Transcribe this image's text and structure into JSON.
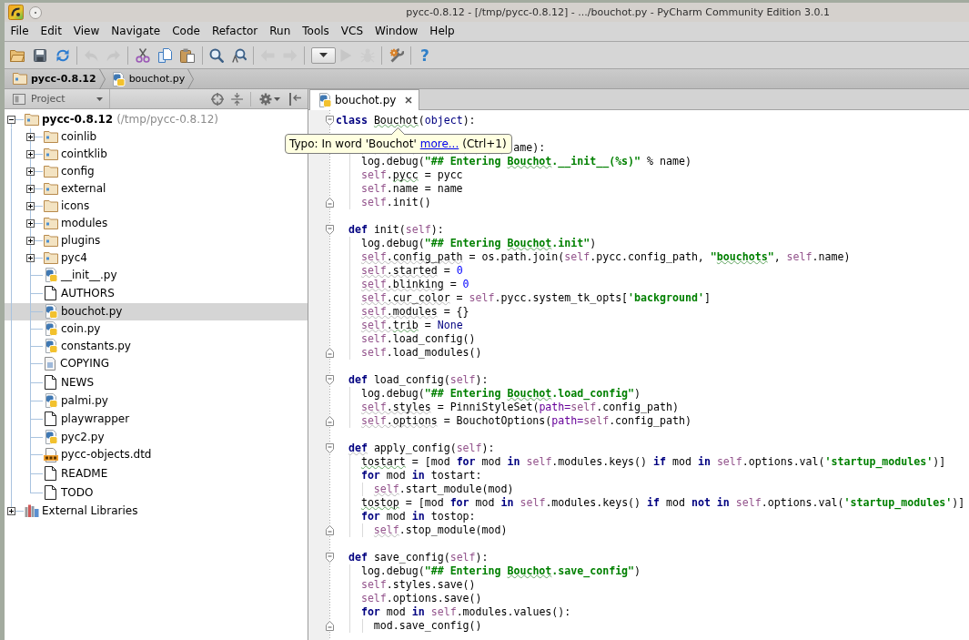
{
  "window": {
    "title": "pycc-0.8.12 - [/tmp/pycc-0.8.12] - .../bouchot.py - PyCharm Community Edition 3.0.1"
  },
  "menu": [
    {
      "label": "File"
    },
    {
      "label": "Edit"
    },
    {
      "label": "View"
    },
    {
      "label": "Navigate"
    },
    {
      "label": "Code"
    },
    {
      "label": "Refactor"
    },
    {
      "label": "Run"
    },
    {
      "label": "Tools"
    },
    {
      "label": "VCS"
    },
    {
      "label": "Window"
    },
    {
      "label": "Help"
    }
  ],
  "toolbar": [
    {
      "kind": "button",
      "disabled": false
    },
    {
      "kind": "button",
      "disabled": false
    },
    {
      "kind": "button",
      "disabled": false
    },
    {
      "kind": "separator"
    },
    {
      "kind": "button",
      "disabled": true
    },
    {
      "kind": "button",
      "disabled": true
    },
    {
      "kind": "separator"
    },
    {
      "kind": "button",
      "disabled": false
    },
    {
      "kind": "button",
      "disabled": false
    },
    {
      "kind": "button",
      "disabled": false
    },
    {
      "kind": "separator"
    },
    {
      "kind": "button",
      "disabled": false
    },
    {
      "kind": "button",
      "disabled": false
    },
    {
      "kind": "separator"
    },
    {
      "kind": "button",
      "disabled": true
    },
    {
      "kind": "button",
      "disabled": true
    },
    {
      "kind": "separator"
    },
    {
      "kind": "dropdown",
      "disabled": false
    },
    {
      "kind": "button",
      "disabled": true
    },
    {
      "kind": "button",
      "disabled": true
    },
    {
      "kind": "separator"
    },
    {
      "kind": "button",
      "disabled": false
    },
    {
      "kind": "separator"
    },
    {
      "kind": "glyph",
      "text": "?",
      "disabled": false
    }
  ],
  "breadcrumbs": [
    {
      "label": "pycc-0.8.12",
      "kind": "project"
    },
    {
      "label": "bouchot.py",
      "kind": "python"
    }
  ],
  "project_panel": {
    "title": "Project",
    "tree": [
      {
        "label": "pycc-0.8.12",
        "detail": "(/tmp/pycc-0.8.12)",
        "kind": "project",
        "expanded": true,
        "selected": false,
        "children": [
          {
            "label": "coinlib",
            "kind": "package",
            "expanded": false,
            "selected": false
          },
          {
            "label": "cointklib",
            "kind": "package",
            "expanded": false,
            "selected": false
          },
          {
            "label": "config",
            "kind": "folder",
            "expanded": false,
            "selected": false
          },
          {
            "label": "external",
            "kind": "package",
            "expanded": false,
            "selected": false
          },
          {
            "label": "icons",
            "kind": "folder",
            "expanded": false,
            "selected": false
          },
          {
            "label": "modules",
            "kind": "package",
            "expanded": false,
            "selected": false
          },
          {
            "label": "plugins",
            "kind": "package",
            "expanded": false,
            "selected": false
          },
          {
            "label": "pyc4",
            "kind": "package",
            "expanded": false,
            "selected": false
          },
          {
            "label": "__init__.py",
            "kind": "python",
            "selected": false
          },
          {
            "label": "AUTHORS",
            "kind": "file",
            "selected": false
          },
          {
            "label": "bouchot.py",
            "kind": "python",
            "selected": true
          },
          {
            "label": "coin.py",
            "kind": "python",
            "selected": false
          },
          {
            "label": "constants.py",
            "kind": "python",
            "selected": false
          },
          {
            "label": "COPYING",
            "kind": "document",
            "selected": false
          },
          {
            "label": "NEWS",
            "kind": "file",
            "selected": false
          },
          {
            "label": "palmi.py",
            "kind": "python",
            "selected": false
          },
          {
            "label": "playwrapper",
            "kind": "file",
            "selected": false
          },
          {
            "label": "pyc2.py",
            "kind": "python",
            "selected": false
          },
          {
            "label": "pycc-objects.dtd",
            "kind": "dtd",
            "selected": false
          },
          {
            "label": "README",
            "kind": "file",
            "selected": false
          },
          {
            "label": "TODO",
            "kind": "file",
            "selected": false
          }
        ]
      },
      {
        "label": "External Libraries",
        "kind": "library",
        "expanded": false,
        "selected": false
      }
    ]
  },
  "editor": {
    "tabs": [
      {
        "label": "bouchot.py",
        "kind": "python",
        "selected": true
      }
    ],
    "lines": [
      {
        "kind": "code",
        "fold": {
          "kind": "start"
        },
        "segments": [
          {
            "text": "class ",
            "kind": "keyword"
          },
          {
            "text": "Bouchot",
            "kind": "plain",
            "squiggle": {
              "kind": "typo"
            }
          },
          {
            "text": "(",
            "kind": "plain"
          },
          {
            "text": "object",
            "kind": "builtin"
          },
          {
            "text": "):",
            "kind": "plain"
          }
        ]
      },
      {
        "kind": "blank"
      },
      {
        "kind": "code",
        "segments": [
          {
            "text": "                            ame):",
            "kind": "plain"
          }
        ]
      },
      {
        "kind": "code",
        "segments": [
          {
            "text": "    log.debug(",
            "kind": "plain"
          },
          {
            "text": "\"## Entering ",
            "kind": "string"
          },
          {
            "text": "Bouchot",
            "kind": "string",
            "squiggle": {
              "kind": "typo"
            }
          },
          {
            "text": ".__init__(%s)\"",
            "kind": "string"
          },
          {
            "text": " % name)",
            "kind": "plain"
          }
        ]
      },
      {
        "kind": "code",
        "segments": [
          {
            "text": "    self",
            "kind": "self"
          },
          {
            "text": ".",
            "kind": "plain"
          },
          {
            "text": "pycc",
            "kind": "plain",
            "squiggle": {
              "kind": "typo"
            }
          },
          {
            "text": " = pycc",
            "kind": "plain"
          }
        ]
      },
      {
        "kind": "code",
        "segments": [
          {
            "text": "    self",
            "kind": "self"
          },
          {
            "text": ".name = name",
            "kind": "plain"
          }
        ]
      },
      {
        "kind": "code",
        "fold": {
          "kind": "end"
        },
        "segments": [
          {
            "text": "    self",
            "kind": "self"
          },
          {
            "text": ".init()",
            "kind": "plain"
          }
        ]
      },
      {
        "kind": "blank"
      },
      {
        "kind": "code",
        "fold": {
          "kind": "start"
        },
        "segments": [
          {
            "text": "  def",
            "kind": "keyword"
          },
          {
            "text": " init(",
            "kind": "plain"
          },
          {
            "text": "self",
            "kind": "self"
          },
          {
            "text": "):",
            "kind": "plain"
          }
        ]
      },
      {
        "kind": "code",
        "segments": [
          {
            "text": "    log.debug(",
            "kind": "plain"
          },
          {
            "text": "\"## Entering ",
            "kind": "string"
          },
          {
            "text": "Bouchot",
            "kind": "string",
            "squiggle": {
              "kind": "typo"
            }
          },
          {
            "text": ".init\"",
            "kind": "string"
          },
          {
            "text": ")",
            "kind": "plain"
          }
        ]
      },
      {
        "kind": "code",
        "segments": [
          {
            "text": "    self",
            "kind": "self",
            "squiggle": {
              "kind": "warning"
            }
          },
          {
            "text": ".config_path",
            "kind": "plain",
            "squiggle": {
              "kind": "warning"
            }
          },
          {
            "text": " = os.path.join(",
            "kind": "plain"
          },
          {
            "text": "self",
            "kind": "self"
          },
          {
            "text": ".pycc.config_path, ",
            "kind": "plain"
          },
          {
            "text": "\"",
            "kind": "string"
          },
          {
            "text": "bouchots",
            "kind": "string",
            "squiggle": {
              "kind": "typo"
            }
          },
          {
            "text": "\"",
            "kind": "string"
          },
          {
            "text": ", ",
            "kind": "plain"
          },
          {
            "text": "self",
            "kind": "self"
          },
          {
            "text": ".name)",
            "kind": "plain"
          }
        ]
      },
      {
        "kind": "code",
        "segments": [
          {
            "text": "    self",
            "kind": "self",
            "squiggle": {
              "kind": "warning"
            }
          },
          {
            "text": ".started",
            "kind": "plain",
            "squiggle": {
              "kind": "warning"
            }
          },
          {
            "text": " = ",
            "kind": "plain"
          },
          {
            "text": "0",
            "kind": "number"
          }
        ]
      },
      {
        "kind": "code",
        "segments": [
          {
            "text": "    self",
            "kind": "self",
            "squiggle": {
              "kind": "warning"
            }
          },
          {
            "text": ".blinking",
            "kind": "plain",
            "squiggle": {
              "kind": "warning"
            }
          },
          {
            "text": " = ",
            "kind": "plain"
          },
          {
            "text": "0",
            "kind": "number"
          }
        ]
      },
      {
        "kind": "code",
        "segments": [
          {
            "text": "    self",
            "kind": "self",
            "squiggle": {
              "kind": "warning"
            }
          },
          {
            "text": ".cur_color",
            "kind": "plain",
            "squiggle": {
              "kind": "warning"
            }
          },
          {
            "text": " = ",
            "kind": "plain"
          },
          {
            "text": "self",
            "kind": "self"
          },
          {
            "text": ".pycc.system_tk_opts[",
            "kind": "plain"
          },
          {
            "text": "'background'",
            "kind": "string"
          },
          {
            "text": "]",
            "kind": "plain"
          }
        ]
      },
      {
        "kind": "code",
        "segments": [
          {
            "text": "    self",
            "kind": "self",
            "squiggle": {
              "kind": "warning"
            }
          },
          {
            "text": ".modules",
            "kind": "plain",
            "squiggle": {
              "kind": "warning"
            }
          },
          {
            "text": " = {}",
            "kind": "plain"
          }
        ]
      },
      {
        "kind": "code",
        "segments": [
          {
            "text": "    self",
            "kind": "self",
            "squiggle": {
              "kind": "warning"
            }
          },
          {
            "text": ".",
            "kind": "plain",
            "squiggle": {
              "kind": "warning"
            }
          },
          {
            "text": "trib",
            "kind": "plain",
            "squiggle": {
              "kind": "typo"
            }
          },
          {
            "text": " = ",
            "kind": "plain"
          },
          {
            "text": "None",
            "kind": "constant"
          }
        ]
      },
      {
        "kind": "code",
        "segments": [
          {
            "text": "    self",
            "kind": "self"
          },
          {
            "text": ".load_config()",
            "kind": "plain"
          }
        ]
      },
      {
        "kind": "code",
        "fold": {
          "kind": "end"
        },
        "segments": [
          {
            "text": "    self",
            "kind": "self"
          },
          {
            "text": ".load_modules()",
            "kind": "plain"
          }
        ]
      },
      {
        "kind": "blank"
      },
      {
        "kind": "code",
        "fold": {
          "kind": "start"
        },
        "segments": [
          {
            "text": "  def",
            "kind": "keyword"
          },
          {
            "text": " load_config(",
            "kind": "plain"
          },
          {
            "text": "self",
            "kind": "self"
          },
          {
            "text": "):",
            "kind": "plain"
          }
        ]
      },
      {
        "kind": "code",
        "segments": [
          {
            "text": "    log.debug(",
            "kind": "plain"
          },
          {
            "text": "\"## Entering ",
            "kind": "string"
          },
          {
            "text": "Bouchot",
            "kind": "string",
            "squiggle": {
              "kind": "typo"
            }
          },
          {
            "text": ".load_config\"",
            "kind": "string"
          },
          {
            "text": ")",
            "kind": "plain"
          }
        ]
      },
      {
        "kind": "code",
        "segments": [
          {
            "text": "    self",
            "kind": "self",
            "squiggle": {
              "kind": "warning"
            }
          },
          {
            "text": ".styles",
            "kind": "plain",
            "squiggle": {
              "kind": "warning"
            }
          },
          {
            "text": " = PinniStyleSet(",
            "kind": "plain"
          },
          {
            "text": "path=",
            "kind": "param"
          },
          {
            "text": "self",
            "kind": "self"
          },
          {
            "text": ".config_path)",
            "kind": "plain"
          }
        ]
      },
      {
        "kind": "code",
        "fold": {
          "kind": "end"
        },
        "segments": [
          {
            "text": "    self",
            "kind": "self",
            "squiggle": {
              "kind": "warning"
            }
          },
          {
            "text": ".options",
            "kind": "plain",
            "squiggle": {
              "kind": "warning"
            }
          },
          {
            "text": " = BouchotOptions(",
            "kind": "plain"
          },
          {
            "text": "path=",
            "kind": "param"
          },
          {
            "text": "self",
            "kind": "self"
          },
          {
            "text": ".config_path)",
            "kind": "plain"
          }
        ]
      },
      {
        "kind": "blank"
      },
      {
        "kind": "code",
        "fold": {
          "kind": "start"
        },
        "segments": [
          {
            "text": "  def",
            "kind": "keyword",
            "squiggle": {
              "kind": "warning"
            }
          },
          {
            "text": " apply_config(",
            "kind": "plain"
          },
          {
            "text": "self",
            "kind": "self"
          },
          {
            "text": "):",
            "kind": "plain"
          }
        ]
      },
      {
        "kind": "code",
        "segments": [
          {
            "text": "    tostart",
            "kind": "plain",
            "squiggle": {
              "kind": "typo"
            }
          },
          {
            "text": " = [mod ",
            "kind": "plain"
          },
          {
            "text": "for",
            "kind": "keyword"
          },
          {
            "text": " mod ",
            "kind": "plain"
          },
          {
            "text": "in ",
            "kind": "keyword"
          },
          {
            "text": "self",
            "kind": "self"
          },
          {
            "text": ".modules.keys() ",
            "kind": "plain"
          },
          {
            "text": "if",
            "kind": "keyword"
          },
          {
            "text": " mod ",
            "kind": "plain"
          },
          {
            "text": "in ",
            "kind": "keyword"
          },
          {
            "text": "self",
            "kind": "self"
          },
          {
            "text": ".options.val(",
            "kind": "plain"
          },
          {
            "text": "'startup_modules'",
            "kind": "string"
          },
          {
            "text": ")]",
            "kind": "plain"
          }
        ]
      },
      {
        "kind": "code",
        "segments": [
          {
            "text": "    for",
            "kind": "keyword"
          },
          {
            "text": " mod ",
            "kind": "plain"
          },
          {
            "text": "in",
            "kind": "keyword"
          },
          {
            "text": " tostart:",
            "kind": "plain"
          }
        ]
      },
      {
        "kind": "code",
        "segments": [
          {
            "text": "      self",
            "kind": "self",
            "squiggle": {
              "kind": "warning"
            }
          },
          {
            "text": ".start_module(mod)",
            "kind": "plain"
          }
        ]
      },
      {
        "kind": "code",
        "segments": [
          {
            "text": "    tostop",
            "kind": "plain",
            "squiggle": {
              "kind": "typo"
            }
          },
          {
            "text": " = [mod ",
            "kind": "plain"
          },
          {
            "text": "for",
            "kind": "keyword"
          },
          {
            "text": " mod ",
            "kind": "plain"
          },
          {
            "text": "in ",
            "kind": "keyword"
          },
          {
            "text": "self",
            "kind": "self"
          },
          {
            "text": ".modules.keys() ",
            "kind": "plain"
          },
          {
            "text": "if",
            "kind": "keyword"
          },
          {
            "text": " mod ",
            "kind": "plain"
          },
          {
            "text": "not in ",
            "kind": "keyword"
          },
          {
            "text": "self",
            "kind": "self"
          },
          {
            "text": ".options.val(",
            "kind": "plain"
          },
          {
            "text": "'startup_modules'",
            "kind": "string"
          },
          {
            "text": ")]",
            "kind": "plain"
          }
        ]
      },
      {
        "kind": "code",
        "segments": [
          {
            "text": "    for",
            "kind": "keyword"
          },
          {
            "text": " mod ",
            "kind": "plain"
          },
          {
            "text": "in",
            "kind": "keyword"
          },
          {
            "text": " tostop:",
            "kind": "plain"
          }
        ]
      },
      {
        "kind": "code",
        "fold": {
          "kind": "end"
        },
        "segments": [
          {
            "text": "      self",
            "kind": "self",
            "squiggle": {
              "kind": "warning"
            }
          },
          {
            "text": ".stop_module(mod)",
            "kind": "plain"
          }
        ]
      },
      {
        "kind": "blank"
      },
      {
        "kind": "code",
        "fold": {
          "kind": "start"
        },
        "segments": [
          {
            "text": "  def",
            "kind": "keyword"
          },
          {
            "text": " save_config(",
            "kind": "plain"
          },
          {
            "text": "self",
            "kind": "self"
          },
          {
            "text": "):",
            "kind": "plain"
          }
        ]
      },
      {
        "kind": "code",
        "segments": [
          {
            "text": "    log.debug(",
            "kind": "plain"
          },
          {
            "text": "\"## Entering ",
            "kind": "string"
          },
          {
            "text": "Bouchot",
            "kind": "string",
            "squiggle": {
              "kind": "typo"
            }
          },
          {
            "text": ".save_config\"",
            "kind": "string"
          },
          {
            "text": ")",
            "kind": "plain"
          }
        ]
      },
      {
        "kind": "code",
        "segments": [
          {
            "text": "    self",
            "kind": "self"
          },
          {
            "text": ".styles.save()",
            "kind": "plain"
          }
        ]
      },
      {
        "kind": "code",
        "segments": [
          {
            "text": "    self",
            "kind": "self"
          },
          {
            "text": ".options.save()",
            "kind": "plain"
          }
        ]
      },
      {
        "kind": "code",
        "segments": [
          {
            "text": "    for",
            "kind": "keyword"
          },
          {
            "text": " mod ",
            "kind": "plain"
          },
          {
            "text": "in ",
            "kind": "keyword"
          },
          {
            "text": "self",
            "kind": "self"
          },
          {
            "text": ".modules.values():",
            "kind": "plain"
          }
        ]
      },
      {
        "kind": "code",
        "fold": {
          "kind": "end"
        },
        "segments": [
          {
            "text": "      mod.save_config()",
            "kind": "plain"
          }
        ]
      }
    ],
    "tooltip": {
      "message": "Typo: In word 'Bouchot'",
      "link": "more...",
      "shortcut": "(Ctrl+1)"
    }
  }
}
